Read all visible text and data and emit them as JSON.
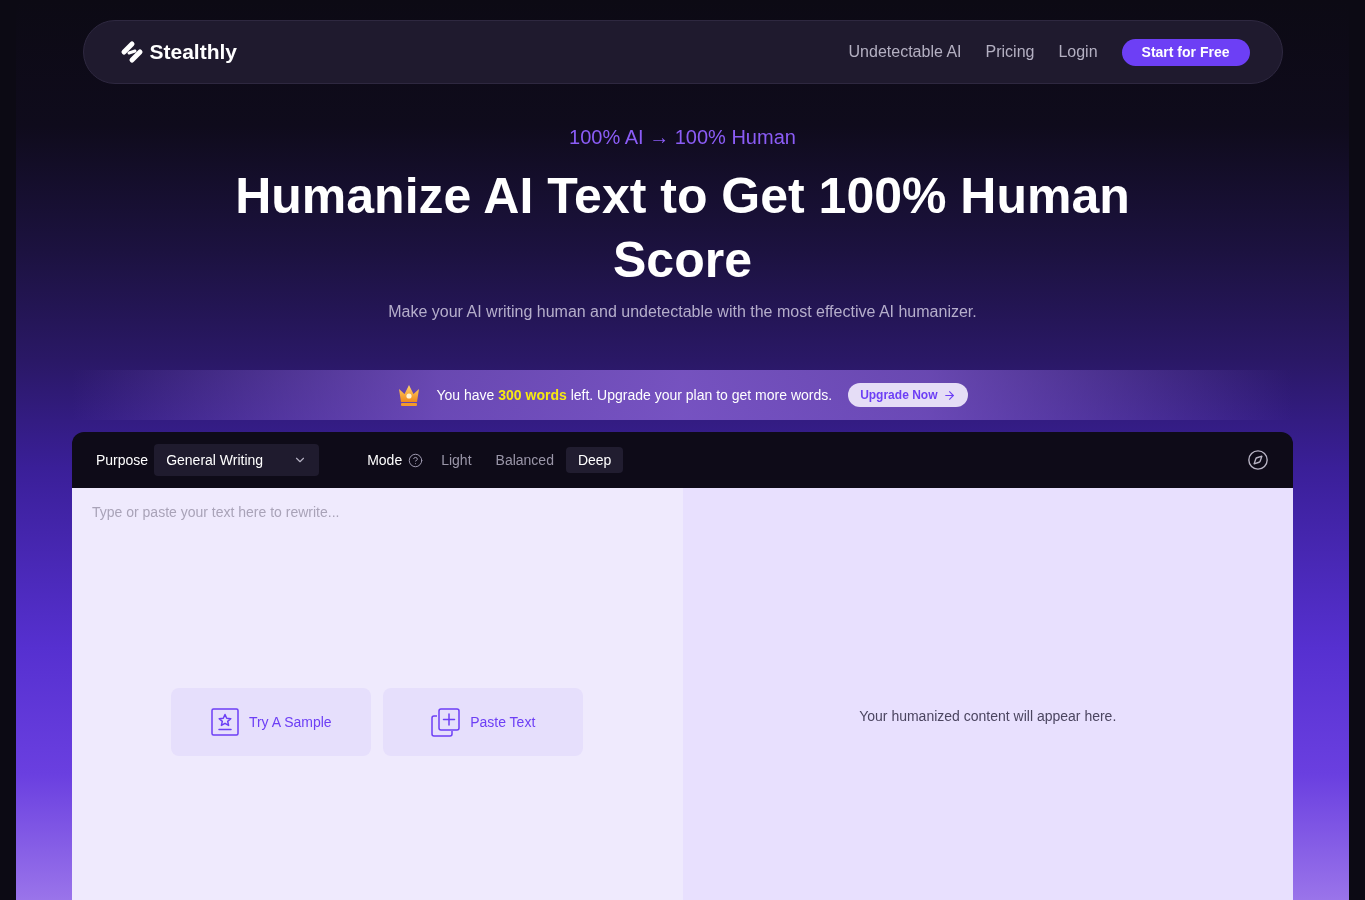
{
  "nav": {
    "logo": "Stealthly",
    "links": [
      {
        "label": "Undetectable AI"
      },
      {
        "label": "Pricing"
      },
      {
        "label": "Login"
      }
    ],
    "cta": "Start for Free"
  },
  "hero": {
    "tagline": "100% AI → 100% Human",
    "title": "Humanize AI Text to Get 100% Human Score",
    "subtitle": "Make your AI writing human and undetectable with the most effective AI humanizer."
  },
  "banner": {
    "text": "You have **300 words** left. Upgrade your plan to get more words.",
    "button": "Upgrade Now"
  },
  "editor": {
    "purpose": {
      "label": "Purpose",
      "value": "General Writing"
    },
    "mode": {
      "label": "Mode",
      "options": [
        {
          "label": "Light",
          "selected": false
        },
        {
          "label": "Balanced",
          "selected": false
        },
        {
          "label": "Deep",
          "selected": true
        }
      ]
    },
    "input": {
      "placeholder": "Type or paste your text here to rewrite..."
    },
    "actions": [
      {
        "kind": "sample",
        "label": "Try A Sample"
      },
      {
        "kind": "paste",
        "label": "Paste Text"
      }
    ],
    "output": {
      "empty_message": "Your humanized content will appear here."
    }
  }
}
